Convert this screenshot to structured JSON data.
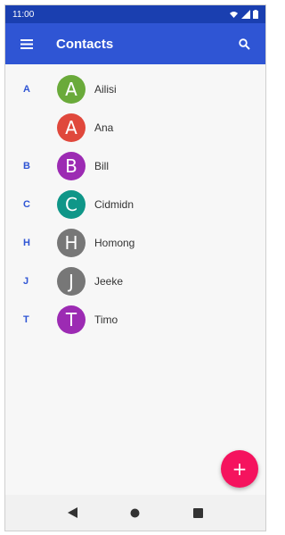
{
  "status_bar": {
    "time": "11:00",
    "icons": [
      "wifi-icon",
      "signal-icon",
      "battery-icon"
    ]
  },
  "app_bar": {
    "title": "Contacts",
    "menu_icon": "hamburger-menu-icon",
    "search_icon": "search-icon",
    "color": "#2f55d4"
  },
  "contacts": [
    {
      "section": "A",
      "initial": "A",
      "name": "Ailisi",
      "color": "#6aaa3a"
    },
    {
      "section": "",
      "initial": "A",
      "name": "Ana",
      "color": "#e0483c"
    },
    {
      "section": "B",
      "initial": "B",
      "name": "Bill",
      "color": "#9c2bb3"
    },
    {
      "section": "C",
      "initial": "C",
      "name": "Cidmidn",
      "color": "#0f9688"
    },
    {
      "section": "H",
      "initial": "H",
      "name": "Homong",
      "color": "#777777"
    },
    {
      "section": "J",
      "initial": "J",
      "name": "Jeeke",
      "color": "#777777"
    },
    {
      "section": "T",
      "initial": "T",
      "name": "Timo",
      "color": "#9c2bb3"
    }
  ],
  "fab": {
    "symbol": "+",
    "color": "#f5135e"
  },
  "nav_bar": {
    "buttons": [
      "back-icon",
      "home-icon",
      "recents-icon"
    ]
  }
}
